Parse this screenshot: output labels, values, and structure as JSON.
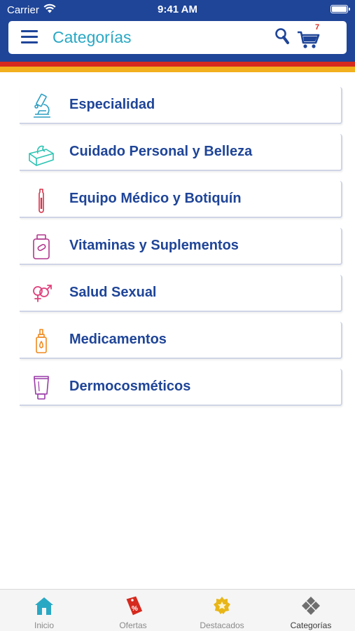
{
  "statusbar": {
    "carrier": "Carrier",
    "time": "9:41 AM"
  },
  "topbar": {
    "title": "Categorías",
    "cart_count": "7"
  },
  "categories": [
    {
      "label": "Especialidad",
      "icon": "microscope-icon"
    },
    {
      "label": "Cuidado Personal y Belleza",
      "icon": "tissue-box-icon"
    },
    {
      "label": "Equipo Médico y Botiquín",
      "icon": "thermometer-icon"
    },
    {
      "label": "Vitaminas y Suplementos",
      "icon": "pill-bottle-icon"
    },
    {
      "label": "Salud Sexual",
      "icon": "gender-symbols-icon"
    },
    {
      "label": "Medicamentos",
      "icon": "dropper-bottle-icon"
    },
    {
      "label": "Dermocosméticos",
      "icon": "cream-tube-icon"
    }
  ],
  "tabs": [
    {
      "label": "Inicio",
      "icon": "home-icon"
    },
    {
      "label": "Ofertas",
      "icon": "price-tag-icon"
    },
    {
      "label": "Destacados",
      "icon": "badge-icon"
    },
    {
      "label": "Categorías",
      "icon": "diamond-grid-icon"
    }
  ],
  "colors": {
    "header": "#1f4598",
    "title": "#29a8c4",
    "category_text": "#1f4598",
    "stripe_red": "#d62a1e",
    "stripe_yellow": "#f2b01e"
  }
}
